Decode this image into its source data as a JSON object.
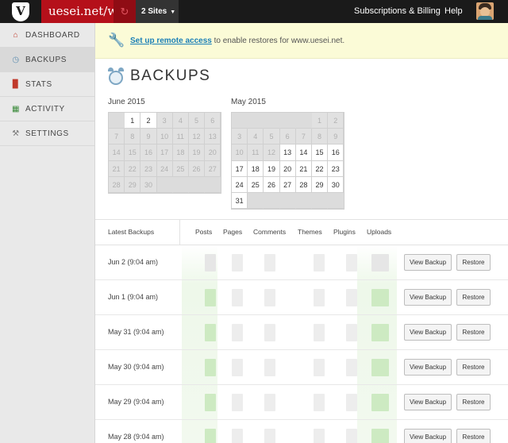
{
  "topbar": {
    "logo_letter": "V",
    "site_title": "uesei.net/wp",
    "sync_icon": "sync-icon",
    "sites_label": "2 Sites",
    "subscriptions_label": "Subscriptions & Billing",
    "help_label": "Help",
    "accent": "#b5101a"
  },
  "sidebar": {
    "items": [
      {
        "label": "DASHBOARD",
        "icon": "house-icon"
      },
      {
        "label": "BACKUPS",
        "icon": "clock-icon"
      },
      {
        "label": "STATS",
        "icon": "chart-icon"
      },
      {
        "label": "ACTIVITY",
        "icon": "activity-icon"
      },
      {
        "label": "SETTINGS",
        "icon": "wrench-icon"
      }
    ]
  },
  "notice": {
    "link_text": "Set up remote access",
    "rest_text": " to enable restores for www.uesei.net."
  },
  "page": {
    "title": "BACKUPS"
  },
  "calendars": [
    {
      "month_label": "June 2015",
      "leading_blanks": 1,
      "days": 30,
      "available": [
        1,
        2
      ]
    },
    {
      "month_label": "May 2015",
      "leading_blanks": 5,
      "days": 31,
      "available": [
        13,
        14,
        15,
        16,
        17,
        18,
        19,
        20,
        21,
        22,
        23,
        24,
        25,
        26,
        27,
        28,
        29,
        30,
        31
      ]
    }
  ],
  "table": {
    "headers": {
      "latest": "Latest Backups",
      "posts": "Posts",
      "pages": "Pages",
      "comments": "Comments",
      "themes": "Themes",
      "plugins": "Plugins",
      "uploads": "Uploads"
    },
    "view_label": "View Backup",
    "restore_label": "Restore",
    "rows": [
      {
        "date": "Jun 2 (9:04 am)"
      },
      {
        "date": "Jun 1 (9:04 am)"
      },
      {
        "date": "May 31 (9:04 am)"
      },
      {
        "date": "May 30 (9:04 am)"
      },
      {
        "date": "May 29 (9:04 am)"
      },
      {
        "date": "May 28 (9:04 am)"
      }
    ]
  }
}
